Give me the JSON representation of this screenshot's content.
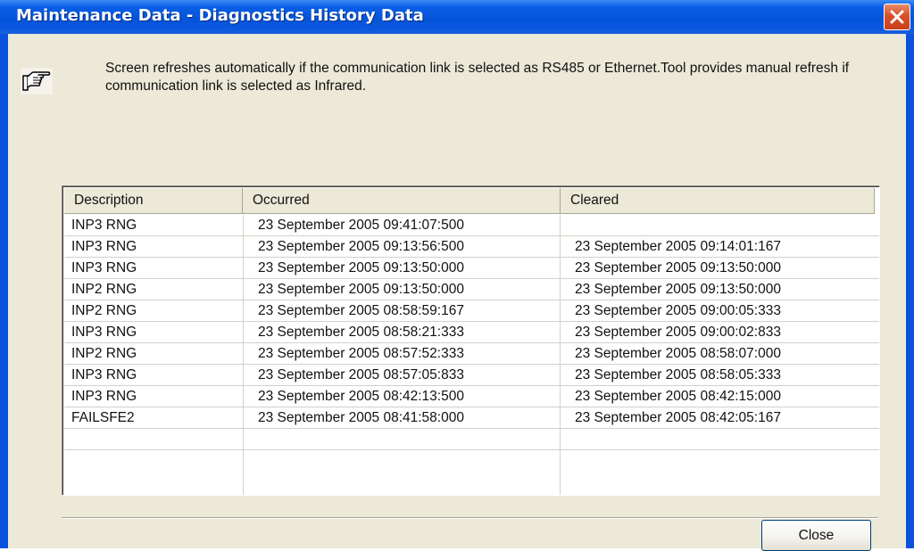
{
  "window": {
    "title": "Maintenance Data - Diagnostics History Data",
    "title_bar_color": "#0a52dd",
    "close_button_color": "#d8502a",
    "background_color": "#ece9d8"
  },
  "info": {
    "icon": "pointing-hand-icon",
    "message": "Screen refreshes automatically if the communication link is selected as RS485 or Ethernet.Tool provides manual refresh if communication link is selected as Infrared."
  },
  "table": {
    "columns": [
      "Description",
      "Occurred",
      "Cleared"
    ],
    "rows": [
      {
        "description": "INP3 RNG",
        "occurred": "23 September 2005 09:41:07:500",
        "cleared": ""
      },
      {
        "description": "INP3 RNG",
        "occurred": "23 September 2005 09:13:56:500",
        "cleared": "23 September 2005 09:14:01:167"
      },
      {
        "description": "INP3 RNG",
        "occurred": "23 September 2005 09:13:50:000",
        "cleared": "23 September 2005 09:13:50:000"
      },
      {
        "description": "INP2 RNG",
        "occurred": "23 September 2005 09:13:50:000",
        "cleared": "23 September 2005 09:13:50:000"
      },
      {
        "description": "INP2 RNG",
        "occurred": "23 September 2005 08:58:59:167",
        "cleared": "23 September 2005 09:00:05:333"
      },
      {
        "description": "INP3 RNG",
        "occurred": "23 September 2005 08:58:21:333",
        "cleared": "23 September 2005 09:00:02:833"
      },
      {
        "description": "INP2 RNG",
        "occurred": "23 September 2005 08:57:52:333",
        "cleared": "23 September 2005 08:58:07:000"
      },
      {
        "description": "INP3 RNG",
        "occurred": "23 September 2005 08:57:05:833",
        "cleared": "23 September 2005 08:58:05:333"
      },
      {
        "description": "INP3 RNG",
        "occurred": "23 September 2005 08:42:13:500",
        "cleared": "23 September 2005 08:42:15:000"
      },
      {
        "description": "FAILSFE2",
        "occurred": "23 September 2005 08:41:58:000",
        "cleared": "23 September 2005 08:42:05:167"
      }
    ]
  },
  "buttons": {
    "close_label": "Close"
  }
}
